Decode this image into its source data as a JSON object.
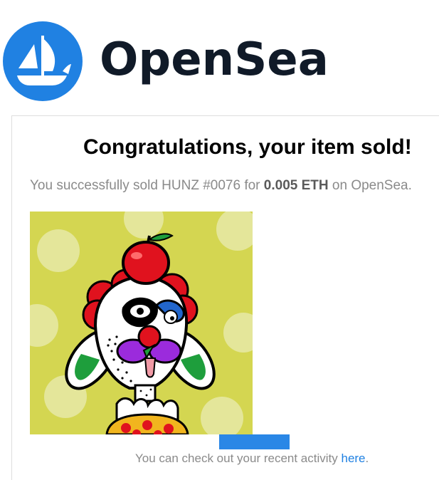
{
  "brand": {
    "name": "OpenSea",
    "logo_icon": "opensea-ship-icon",
    "logo_color": "#2081E2"
  },
  "email": {
    "headline": "Congratulations, your item sold!",
    "sold_prefix": "You successfully sold HUNZ #0076 for ",
    "sold_amount": "0.005 ETH",
    "sold_suffix": " on OpenSea.",
    "item_image": "nft-artwork-clown-with-apple",
    "item_image_bg": "#d4d651",
    "button_color": "#2A87E6",
    "activity_prefix": "You can check out your recent activity ",
    "activity_link": "here",
    "activity_suffix": "."
  }
}
